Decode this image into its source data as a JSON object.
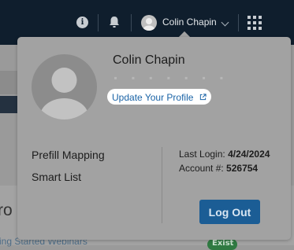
{
  "topbar": {
    "icons": [
      "info-icon",
      "bell-icon",
      "apps-grid-icon"
    ],
    "info_glyph": "i",
    "user_name": "Colin Chapin",
    "dropdown_icon": "chevron-down-icon"
  },
  "profile": {
    "name": "Colin Chapin",
    "email_masked": "▪ ▪ ▪ ▪ ▪ ▪ ▪",
    "update_link": "Update Your Profile",
    "update_link_icon": "external-link-icon"
  },
  "menu": {
    "items": [
      {
        "label": "Prefill Mapping"
      },
      {
        "label": "Smart List"
      }
    ]
  },
  "account": {
    "last_login_label": "Last Login:",
    "last_login_value": "4/24/2024",
    "account_label": "Account #:",
    "account_value": "526754",
    "logout_label": "Log Out"
  },
  "background": {
    "heading_fragment": "ro",
    "link_fragment": "ing Started Webinars",
    "pill_fragment": "Exist"
  },
  "colors": {
    "topbar": "#0f1e2d",
    "accent": "#1b5d95",
    "link": "#1a63a6",
    "overlay": "#a2a2a2"
  }
}
